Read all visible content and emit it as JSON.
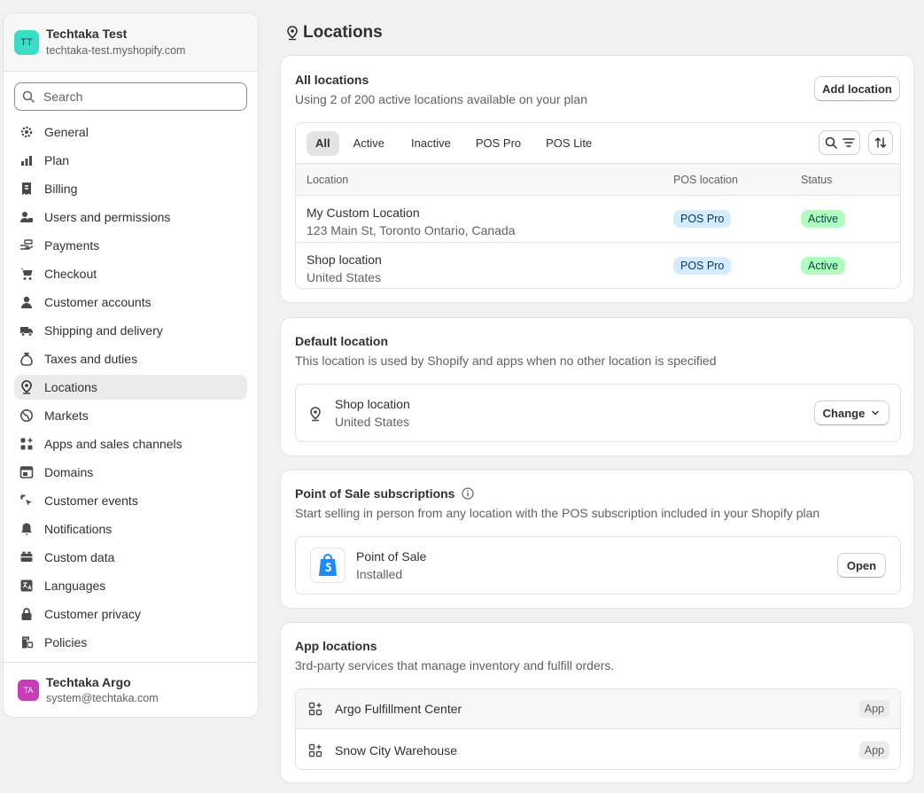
{
  "store": {
    "initials": "TT",
    "name": "Techtaka Test",
    "url": "techtaka-test.myshopify.com"
  },
  "search": {
    "placeholder": "Search"
  },
  "nav": [
    {
      "label": "General",
      "icon": "gear-icon"
    },
    {
      "label": "Plan",
      "icon": "plan-icon"
    },
    {
      "label": "Billing",
      "icon": "receipt-icon"
    },
    {
      "label": "Users and permissions",
      "icon": "users-icon"
    },
    {
      "label": "Payments",
      "icon": "hand-money-icon"
    },
    {
      "label": "Checkout",
      "icon": "cart-icon"
    },
    {
      "label": "Customer accounts",
      "icon": "person-icon"
    },
    {
      "label": "Shipping and delivery",
      "icon": "truck-icon"
    },
    {
      "label": "Taxes and duties",
      "icon": "money-bag-icon"
    },
    {
      "label": "Locations",
      "icon": "location-pin-icon"
    },
    {
      "label": "Markets",
      "icon": "globe-icon"
    },
    {
      "label": "Apps and sales channels",
      "icon": "apps-icon"
    },
    {
      "label": "Domains",
      "icon": "domain-icon"
    },
    {
      "label": "Customer events",
      "icon": "cursor-click-icon"
    },
    {
      "label": "Notifications",
      "icon": "bell-icon"
    },
    {
      "label": "Custom data",
      "icon": "database-icon"
    },
    {
      "label": "Languages",
      "icon": "language-icon"
    },
    {
      "label": "Customer privacy",
      "icon": "lock-icon"
    },
    {
      "label": "Policies",
      "icon": "policy-icon"
    }
  ],
  "active_nav": "Locations",
  "user": {
    "initials": "TA",
    "name": "Techtaka Argo",
    "email": "system@techtaka.com"
  },
  "page": {
    "title": "Locations"
  },
  "all_locations": {
    "title": "All locations",
    "subtitle": "Using 2 of 200 active locations available on your plan",
    "add_button": "Add location",
    "tabs": [
      "All",
      "Active",
      "Inactive",
      "POS Pro",
      "POS Lite"
    ],
    "selected_tab": "All",
    "columns": [
      "Location",
      "POS location",
      "Status"
    ],
    "rows": [
      {
        "name": "My Custom Location",
        "address": "123 Main St, Toronto Ontario, Canada",
        "pos": "POS Pro",
        "status": "Active"
      },
      {
        "name": "Shop location",
        "address": "United States",
        "pos": "POS Pro",
        "status": "Active"
      }
    ]
  },
  "default_location": {
    "title": "Default location",
    "subtitle": "This location is used by Shopify and apps when no other location is specified",
    "name": "Shop location",
    "address": "United States",
    "change_button": "Change"
  },
  "pos_subscriptions": {
    "title": "Point of Sale subscriptions",
    "subtitle": "Start selling in person from any location with the POS subscription included in your Shopify plan",
    "app_name": "Point of Sale",
    "app_status": "Installed",
    "open_button": "Open"
  },
  "app_locations": {
    "title": "App locations",
    "subtitle": "3rd-party services that manage inventory and fulfill orders.",
    "items": [
      {
        "name": "Argo Fulfillment Center",
        "badge": "App"
      },
      {
        "name": "Snow City Warehouse",
        "badge": "App"
      }
    ]
  },
  "colors": {
    "active_badge": "#affebf",
    "pos_badge": "#d5ebff",
    "store_avatar": "#3ddcc7",
    "user_avatar": "#c53db7",
    "shopify_green": "#95bf47",
    "pos_blue": "#1a8cff"
  }
}
